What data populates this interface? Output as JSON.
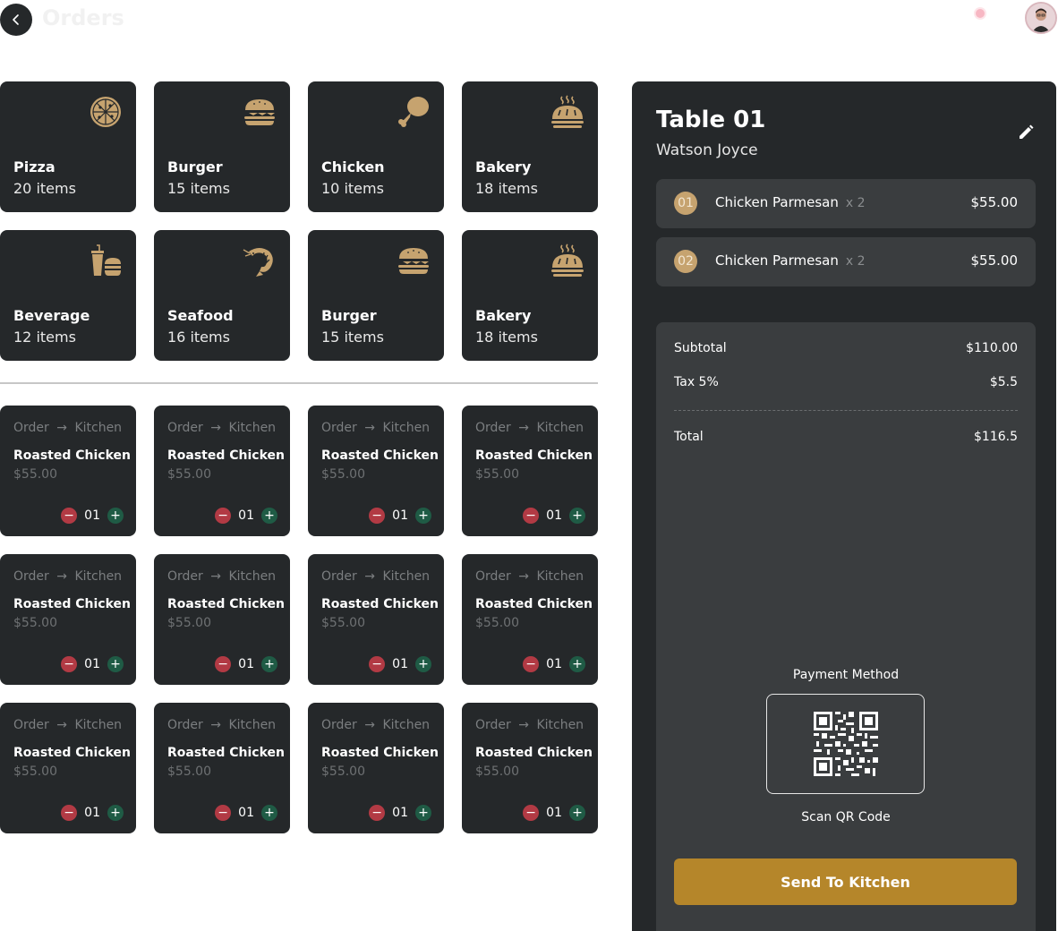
{
  "header": {
    "title": "Orders"
  },
  "colors": {
    "card_bg": "#25282a",
    "accent_gold": "#c6a36f",
    "button_gold": "#b5862a",
    "minus_red": "#b23a44",
    "plus_green": "#1f5b45"
  },
  "categories": [
    {
      "name": "Pizza",
      "count": "20 items",
      "icon": "pizza-icon"
    },
    {
      "name": "Burger",
      "count": "15 items",
      "icon": "burger-icon"
    },
    {
      "name": "Chicken",
      "count": "10 items",
      "icon": "chicken-leg-icon"
    },
    {
      "name": "Bakery",
      "count": "18 items",
      "icon": "bread-icon"
    },
    {
      "name": "Beverage",
      "count": "12 items",
      "icon": "drink-burger-icon"
    },
    {
      "name": "Seafood",
      "count": "16 items",
      "icon": "shrimp-icon"
    },
    {
      "name": "Burger",
      "count": "15 items",
      "icon": "burger-icon"
    },
    {
      "name": "Bakery",
      "count": "18 items",
      "icon": "bread-icon"
    }
  ],
  "products": [
    {
      "route_from": "Order",
      "route_to": "Kitchen",
      "name": "Roasted Chicken",
      "price": "$55.00",
      "qty": "01"
    },
    {
      "route_from": "Order",
      "route_to": "Kitchen",
      "name": "Roasted Chicken",
      "price": "$55.00",
      "qty": "01"
    },
    {
      "route_from": "Order",
      "route_to": "Kitchen",
      "name": "Roasted Chicken",
      "price": "$55.00",
      "qty": "01"
    },
    {
      "route_from": "Order",
      "route_to": "Kitchen",
      "name": "Roasted Chicken",
      "price": "$55.00",
      "qty": "01"
    },
    {
      "route_from": "Order",
      "route_to": "Kitchen",
      "name": "Roasted Chicken",
      "price": "$55.00",
      "qty": "01"
    },
    {
      "route_from": "Order",
      "route_to": "Kitchen",
      "name": "Roasted Chicken",
      "price": "$55.00",
      "qty": "01"
    },
    {
      "route_from": "Order",
      "route_to": "Kitchen",
      "name": "Roasted Chicken",
      "price": "$55.00",
      "qty": "01"
    },
    {
      "route_from": "Order",
      "route_to": "Kitchen",
      "name": "Roasted Chicken",
      "price": "$55.00",
      "qty": "01"
    },
    {
      "route_from": "Order",
      "route_to": "Kitchen",
      "name": "Roasted Chicken",
      "price": "$55.00",
      "qty": "01"
    },
    {
      "route_from": "Order",
      "route_to": "Kitchen",
      "name": "Roasted Chicken",
      "price": "$55.00",
      "qty": "01"
    },
    {
      "route_from": "Order",
      "route_to": "Kitchen",
      "name": "Roasted Chicken",
      "price": "$55.00",
      "qty": "01"
    },
    {
      "route_from": "Order",
      "route_to": "Kitchen",
      "name": "Roasted Chicken",
      "price": "$55.00",
      "qty": "01"
    }
  ],
  "order_panel": {
    "table": "Table 01",
    "customer": "Watson Joyce",
    "items": [
      {
        "num": "01",
        "name": "Chicken Parmesan",
        "qty": "x 2",
        "price": "$55.00"
      },
      {
        "num": "02",
        "name": "Chicken Parmesan",
        "qty": "x 2",
        "price": "$55.00"
      }
    ],
    "summary": {
      "subtotal_label": "Subtotal",
      "subtotal": "$110.00",
      "tax_label": "Tax 5%",
      "tax": "$5.5",
      "total_label": "Total",
      "total": "$116.5"
    },
    "payment_label": "Payment Method",
    "qr_label": "Scan QR Code",
    "send_button": "Send To Kitchen"
  }
}
